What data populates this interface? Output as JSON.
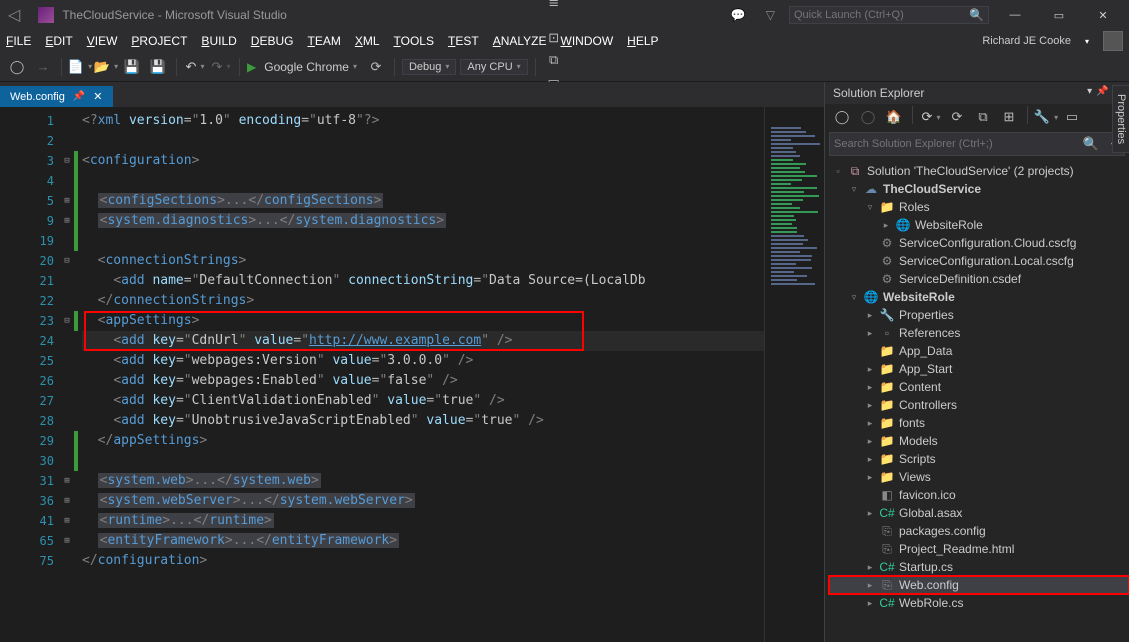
{
  "title": "TheCloudService - Microsoft Visual Studio",
  "quickLaunch": {
    "placeholder": "Quick Launch (Ctrl+Q)"
  },
  "menus": [
    "FILE",
    "EDIT",
    "VIEW",
    "PROJECT",
    "BUILD",
    "DEBUG",
    "TEAM",
    "XML",
    "TOOLS",
    "TEST",
    "ANALYZE",
    "WINDOW",
    "HELP"
  ],
  "user": "Richard JE Cooke",
  "toolbar": {
    "runTarget": "Google Chrome",
    "config": "Debug",
    "platform": "Any CPU"
  },
  "tab": {
    "name": "Web.config"
  },
  "code": {
    "lines": [
      {
        "n": "1",
        "html": "<span class='c-delim'>&lt;?</span><span class='c-tag'>xml</span> <span class='c-attr'>version</span><span class='c-eq'>=</span><span class='c-delim'>\"</span><span class='c-str'>1.0</span><span class='c-delim'>\"</span> <span class='c-attr'>encoding</span><span class='c-eq'>=</span><span class='c-delim'>\"</span><span class='c-str'>utf-8</span><span class='c-delim'>\"?&gt;</span>"
      },
      {
        "n": "2",
        "html": ""
      },
      {
        "n": "3",
        "fold": "⊟",
        "stripe": "g",
        "html": "<span class='c-delim'>&lt;</span><span class='c-tag'>configuration</span><span class='c-delim'>&gt;</span>"
      },
      {
        "n": "4",
        "stripe": "g",
        "html": ""
      },
      {
        "n": "5",
        "fold": "⊞",
        "stripe": "g",
        "html": "  <span class='collapsed'><span class='c-delim'>&lt;</span><span class='c-tag'>configSections</span><span class='c-delim'>&gt;...&lt;/</span><span class='c-tag'>configSections</span><span class='c-delim'>&gt;</span></span>"
      },
      {
        "n": "9",
        "fold": "⊞",
        "stripe": "g",
        "html": "  <span class='collapsed'><span class='c-delim'>&lt;</span><span class='c-tag'>system.diagnostics</span><span class='c-delim'>&gt;...&lt;/</span><span class='c-tag'>system.diagnostics</span><span class='c-delim'>&gt;</span></span>"
      },
      {
        "n": "19",
        "stripe": "g",
        "html": ""
      },
      {
        "n": "20",
        "fold": "⊟",
        "html": "  <span class='c-delim'>&lt;</span><span class='c-tag'>connectionStrings</span><span class='c-delim'>&gt;</span>"
      },
      {
        "n": "21",
        "html": "    <span class='c-delim'>&lt;</span><span class='c-tag'>add</span> <span class='c-attr'>name</span><span class='c-eq'>=</span><span class='c-delim'>\"</span><span class='c-str'>DefaultConnection</span><span class='c-delim'>\"</span> <span class='c-attr'>connectionString</span><span class='c-eq'>=</span><span class='c-delim'>\"</span><span class='c-str'>Data Source=(LocalDb</span>"
      },
      {
        "n": "22",
        "html": "  <span class='c-delim'>&lt;/</span><span class='c-tag'>connectionStrings</span><span class='c-delim'>&gt;</span>"
      },
      {
        "n": "23",
        "fold": "⊟",
        "stripe": "g",
        "boxStart": true,
        "html": "  <span class='c-delim'>&lt;</span><span class='c-tag'>appSettings</span><span class='c-delim'>&gt;</span>"
      },
      {
        "n": "24",
        "hl": true,
        "boxEnd": true,
        "html": "    <span class='c-delim'>&lt;</span><span class='c-tag'>add</span> <span class='c-attr'>key</span><span class='c-eq'>=</span><span class='c-delim'>\"</span><span class='c-str'>CdnUrl</span><span class='c-delim'>\"</span> <span class='c-attr'>value</span><span class='c-eq'>=</span><span class='c-delim'>\"</span><span class='c-url'>http://www.example.com</span><span class='c-delim'>\" /&gt;</span>"
      },
      {
        "n": "25",
        "html": "    <span class='c-delim'>&lt;</span><span class='c-tag'>add</span> <span class='c-attr'>key</span><span class='c-eq'>=</span><span class='c-delim'>\"</span><span class='c-str'>webpages:Version</span><span class='c-delim'>\"</span> <span class='c-attr'>value</span><span class='c-eq'>=</span><span class='c-delim'>\"</span><span class='c-str'>3.0.0.0</span><span class='c-delim'>\" /&gt;</span>"
      },
      {
        "n": "26",
        "html": "    <span class='c-delim'>&lt;</span><span class='c-tag'>add</span> <span class='c-attr'>key</span><span class='c-eq'>=</span><span class='c-delim'>\"</span><span class='c-str'>webpages:Enabled</span><span class='c-delim'>\"</span> <span class='c-attr'>value</span><span class='c-eq'>=</span><span class='c-delim'>\"</span><span class='c-str'>false</span><span class='c-delim'>\" /&gt;</span>"
      },
      {
        "n": "27",
        "html": "    <span class='c-delim'>&lt;</span><span class='c-tag'>add</span> <span class='c-attr'>key</span><span class='c-eq'>=</span><span class='c-delim'>\"</span><span class='c-str'>ClientValidationEnabled</span><span class='c-delim'>\"</span> <span class='c-attr'>value</span><span class='c-eq'>=</span><span class='c-delim'>\"</span><span class='c-str'>true</span><span class='c-delim'>\" /&gt;</span>"
      },
      {
        "n": "28",
        "html": "    <span class='c-delim'>&lt;</span><span class='c-tag'>add</span> <span class='c-attr'>key</span><span class='c-eq'>=</span><span class='c-delim'>\"</span><span class='c-str'>UnobtrusiveJavaScriptEnabled</span><span class='c-delim'>\"</span> <span class='c-attr'>value</span><span class='c-eq'>=</span><span class='c-delim'>\"</span><span class='c-str'>true</span><span class='c-delim'>\" /&gt;</span>"
      },
      {
        "n": "29",
        "stripe": "g",
        "html": "  <span class='c-delim'>&lt;/</span><span class='c-tag'>appSettings</span><span class='c-delim'>&gt;</span>"
      },
      {
        "n": "30",
        "stripe": "g",
        "html": ""
      },
      {
        "n": "31",
        "fold": "⊞",
        "html": "  <span class='collapsed'><span class='c-delim'>&lt;</span><span class='c-tag'>system.web</span><span class='c-delim'>&gt;...&lt;/</span><span class='c-tag'>system.web</span><span class='c-delim'>&gt;</span></span>"
      },
      {
        "n": "36",
        "fold": "⊞",
        "html": "  <span class='collapsed'><span class='c-delim'>&lt;</span><span class='c-tag'>system.webServer</span><span class='c-delim'>&gt;...&lt;/</span><span class='c-tag'>system.webServer</span><span class='c-delim'>&gt;</span></span>"
      },
      {
        "n": "41",
        "fold": "⊞",
        "html": "  <span class='collapsed'><span class='c-delim'>&lt;</span><span class='c-tag'>runtime</span><span class='c-delim'>&gt;...&lt;/</span><span class='c-tag'>runtime</span><span class='c-delim'>&gt;</span></span>"
      },
      {
        "n": "65",
        "fold": "⊞",
        "html": "  <span class='collapsed'><span class='c-delim'>&lt;</span><span class='c-tag'>entityFramework</span><span class='c-delim'>&gt;...&lt;/</span><span class='c-tag'>entityFramework</span><span class='c-delim'>&gt;</span></span>"
      },
      {
        "n": "75",
        "html": "<span class='c-delim'>&lt;/</span><span class='c-tag'>configuration</span><span class='c-delim'>&gt;</span>"
      }
    ]
  },
  "solution": {
    "title": "Solution Explorer",
    "searchPlaceholder": "Search Solution Explorer (Ctrl+;)",
    "rootLabel": "Solution 'TheCloudService' (2 projects)",
    "nodes": [
      {
        "d": 1,
        "tw": "▿",
        "ico": "☁",
        "cls": "fold-proj",
        "label": "TheCloudService",
        "bold": true
      },
      {
        "d": 2,
        "tw": "▿",
        "ico": "📁",
        "cls": "fold-folder",
        "label": "Roles"
      },
      {
        "d": 3,
        "tw": "▸",
        "ico": "🌐",
        "cls": "fold-file",
        "label": "WebsiteRole"
      },
      {
        "d": 2,
        "tw": "",
        "ico": "⚙",
        "cls": "fold-file",
        "label": "ServiceConfiguration.Cloud.cscfg"
      },
      {
        "d": 2,
        "tw": "",
        "ico": "⚙",
        "cls": "fold-file",
        "label": "ServiceConfiguration.Local.cscfg"
      },
      {
        "d": 2,
        "tw": "",
        "ico": "⚙",
        "cls": "fold-file",
        "label": "ServiceDefinition.csdef"
      },
      {
        "d": 1,
        "tw": "▿",
        "ico": "🌐",
        "cls": "fold-proj",
        "label": "WebsiteRole",
        "bold": true
      },
      {
        "d": 2,
        "tw": "▸",
        "ico": "🔧",
        "cls": "fold-file",
        "label": "Properties"
      },
      {
        "d": 2,
        "tw": "▸",
        "ico": "▫",
        "cls": "fold-file",
        "label": "References"
      },
      {
        "d": 2,
        "tw": "",
        "ico": "📁",
        "cls": "fold-folder",
        "label": "App_Data"
      },
      {
        "d": 2,
        "tw": "▸",
        "ico": "📁",
        "cls": "fold-folder",
        "label": "App_Start"
      },
      {
        "d": 2,
        "tw": "▸",
        "ico": "📁",
        "cls": "fold-folder",
        "label": "Content"
      },
      {
        "d": 2,
        "tw": "▸",
        "ico": "📁",
        "cls": "fold-folder",
        "label": "Controllers"
      },
      {
        "d": 2,
        "tw": "▸",
        "ico": "📁",
        "cls": "fold-folder",
        "label": "fonts"
      },
      {
        "d": 2,
        "tw": "▸",
        "ico": "📁",
        "cls": "fold-folder",
        "label": "Models"
      },
      {
        "d": 2,
        "tw": "▸",
        "ico": "📁",
        "cls": "fold-folder",
        "label": "Scripts"
      },
      {
        "d": 2,
        "tw": "▸",
        "ico": "📁",
        "cls": "fold-folder",
        "label": "Views"
      },
      {
        "d": 2,
        "tw": "",
        "ico": "◧",
        "cls": "fold-file",
        "label": "favicon.ico"
      },
      {
        "d": 2,
        "tw": "▸",
        "ico": "C#",
        "cls": "fold-cs",
        "label": "Global.asax"
      },
      {
        "d": 2,
        "tw": "",
        "ico": "⎘",
        "cls": "fold-file",
        "label": "packages.config"
      },
      {
        "d": 2,
        "tw": "",
        "ico": "⎘",
        "cls": "fold-file",
        "label": "Project_Readme.html"
      },
      {
        "d": 2,
        "tw": "▸",
        "ico": "C#",
        "cls": "fold-cs",
        "label": "Startup.cs"
      },
      {
        "d": 2,
        "tw": "▸",
        "ico": "⎘",
        "cls": "fold-file",
        "label": "Web.config",
        "sel": true,
        "redbox": true
      },
      {
        "d": 2,
        "tw": "▸",
        "ico": "C#",
        "cls": "fold-cs",
        "label": "WebRole.cs"
      }
    ]
  },
  "propTab": "Properties"
}
